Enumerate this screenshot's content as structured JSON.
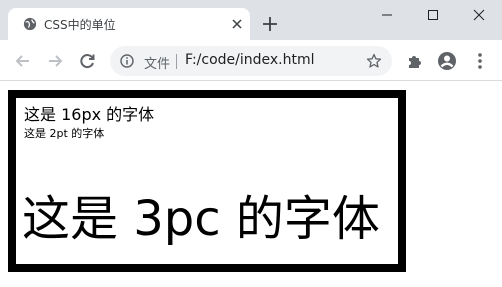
{
  "tab": {
    "title": "CSS中的单位",
    "favicon_icon": "globe-icon",
    "close_icon": "close-icon"
  },
  "new_tab_icon": "plus-icon",
  "window_controls": [
    "minimize-icon",
    "maximize-icon",
    "close-icon"
  ],
  "toolbar": {
    "back_icon": "arrow-left-icon",
    "forward_icon": "arrow-right-icon",
    "reload_icon": "reload-icon",
    "site_info_icon": "info-icon",
    "scheme_label": "文件",
    "url": "F:/code/index.html",
    "bookmark_icon": "star-icon",
    "extensions_icon": "puzzle-icon",
    "profile_icon": "account-icon",
    "menu_icon": "kebab-menu-icon"
  },
  "page": {
    "line_16px": "这是 16px 的字体",
    "line_2pt": "这是 2pt 的字体",
    "line_3pc": "这是 3pc 的字体"
  },
  "colors": {
    "titlebar": "#dee1e6",
    "omnibox": "#f1f3f4",
    "border": "#000000",
    "icon": "#5f6368"
  }
}
